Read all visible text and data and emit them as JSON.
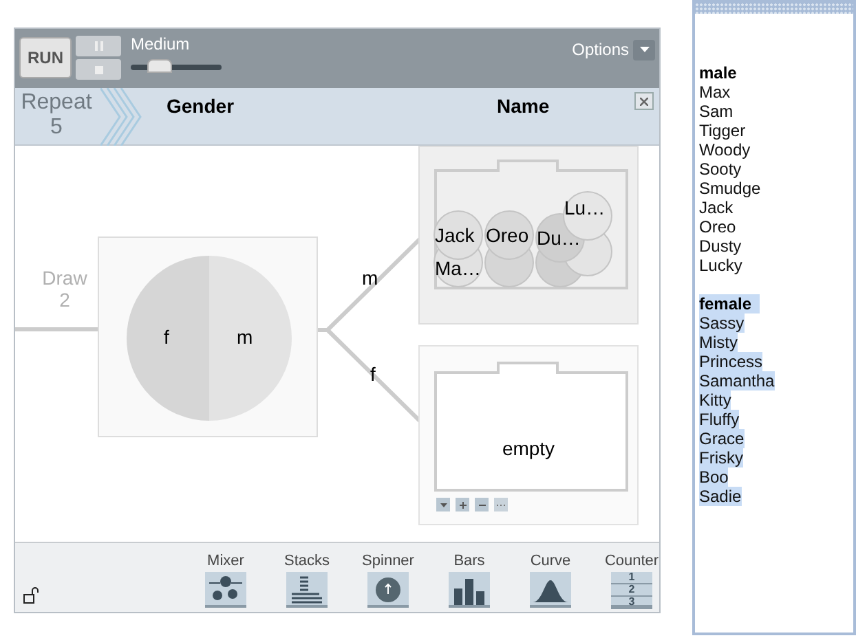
{
  "toolbar": {
    "run": "RUN",
    "speed_label": "Medium",
    "speed": {
      "level": 0.25
    },
    "options": "Options"
  },
  "header": {
    "repeat_label": "Repeat",
    "repeat_count": "5",
    "columns": [
      "Gender",
      "Name"
    ]
  },
  "sampler": {
    "draw_label": "Draw",
    "draw_count": "2",
    "spinner": [
      {
        "label": "f"
      },
      {
        "label": "m"
      }
    ],
    "branches": [
      {
        "label": "m",
        "balls": [
          "Lu…",
          "Jack",
          "Oreo",
          "Du…",
          "Ma…"
        ]
      },
      {
        "label": "f",
        "text": "empty"
      }
    ]
  },
  "devices": [
    {
      "kind": "mixer",
      "label": "Mixer"
    },
    {
      "kind": "stacks",
      "label": "Stacks"
    },
    {
      "kind": "spinner",
      "label": "Spinner"
    },
    {
      "kind": "bars",
      "label": "Bars"
    },
    {
      "kind": "curve",
      "label": "Curve"
    },
    {
      "kind": "counter",
      "label": "Counter",
      "digits": [
        "1",
        "2",
        "3"
      ]
    }
  ],
  "list": [
    {
      "title": "male",
      "selected": false,
      "items": [
        "Max",
        "Sam",
        "Tigger",
        "Woody",
        "Sooty",
        "Smudge",
        "Jack",
        "Oreo",
        "Dusty",
        "Lucky"
      ]
    },
    {
      "title": "female",
      "selected": true,
      "items": [
        "Sassy",
        "Misty",
        "Princess",
        "Samantha",
        "Kitty",
        "Fluffy",
        "Grace",
        "Frisky",
        "Boo",
        "Sadie"
      ]
    }
  ]
}
